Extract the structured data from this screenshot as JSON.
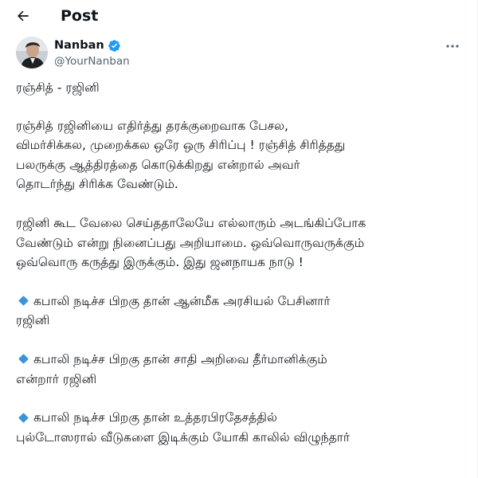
{
  "header": {
    "title": "Post"
  },
  "author": {
    "name": "Nanban",
    "handle": "@YourNanban",
    "verified": true
  },
  "post": {
    "title_line": "ரஞ்சித் - ரஜினி",
    "paragraph_1": "ரஞ்சித் ரஜினியை எதிர்த்து தரக்குறைவாக பேசல,\nவிமர்சிக்கல, முறைக்கல ஒரே ஒரு சிரிப்பு ! ரஞ்சித் சிரித்தது\nபலருக்கு ஆத்திரத்தை கொடுக்கிறது என்றால் அவர்\nதொடர்ந்து சிரிக்க வேண்டும்.",
    "paragraph_2": "ரஜினி கூட வேலை செய்ததாலேயே எல்லாரும் அடங்கிப்போக\nவேண்டும் என்று நினைப்பது அறியாமை. ஒவ்வொருவருக்கும்\nஒவ்வொரு கருத்து இருக்கும். இது ஜனநாயக நாடு !",
    "bullets": [
      {
        "line_1": "கபாலி நடிச்ச பிறகு தான் ஆன்மீக அரசியல் பேசினார்",
        "line_2": "ரஜினி"
      },
      {
        "line_1": "கபாலி நடிச்ச பிறகு தான் சாதி அறிவை தீர்மானிக்கும்",
        "line_2": "என்றார் ரஜினி"
      },
      {
        "line_1": "கபாலி நடிச்ச பிறகு தான் உத்தரபிரதேசத்தில்",
        "line_2": "புல்டோஸரால் வீடுகளை இடிக்கும் யோகி காலில் விழுந்தார்"
      }
    ]
  },
  "icons": {
    "back": "back-arrow-icon",
    "verified": "verified-badge-icon",
    "more": "more-options-icon",
    "bullet": "blue-diamond-icon"
  },
  "colors": {
    "text": "#0f1419",
    "secondary_text": "#536471",
    "verified_blue": "#1d9bf0",
    "bullet_blue": "#3b94d9"
  }
}
